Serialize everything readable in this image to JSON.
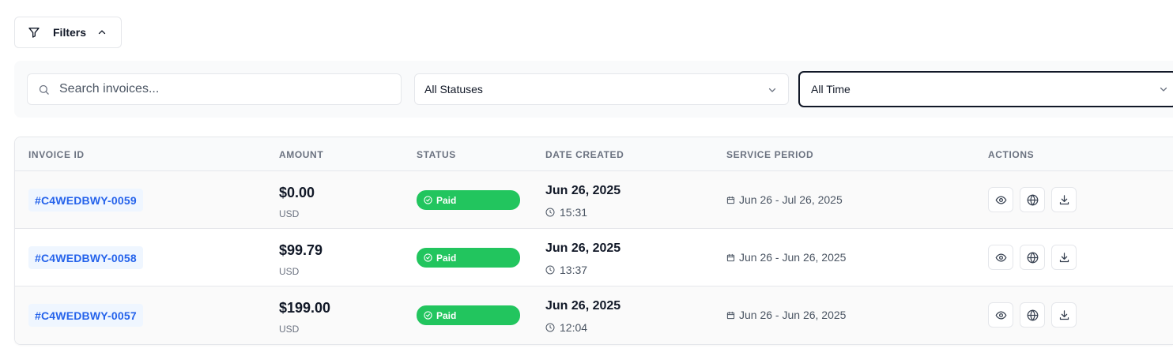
{
  "filters_button": {
    "label": "Filters",
    "icon": "filter-icon",
    "chevron": "chevron-up-icon"
  },
  "search": {
    "placeholder": "Search invoices...",
    "value": "",
    "icon": "search-icon"
  },
  "status_select": {
    "value": "All Statuses",
    "icon": "chevron-down-icon"
  },
  "time_select": {
    "value": "All Time",
    "icon": "chevron-down-icon"
  },
  "table": {
    "headers": {
      "invoice_id": "INVOICE ID",
      "amount": "AMOUNT",
      "status": "STATUS",
      "date_created": "DATE CREATED",
      "service_period": "SERVICE PERIOD",
      "actions": "ACTIONS"
    },
    "rows": [
      {
        "invoice_id": "#C4WEDBWY-0059",
        "amount": "$0.00",
        "currency": "USD",
        "status": "Paid",
        "date": "Jun 26, 2025",
        "time": "15:31",
        "service_period": "Jun 26 - Jul 26, 2025"
      },
      {
        "invoice_id": "#C4WEDBWY-0058",
        "amount": "$99.79",
        "currency": "USD",
        "status": "Paid",
        "date": "Jun 26, 2025",
        "time": "13:37",
        "service_period": "Jun 26 - Jun 26, 2025"
      },
      {
        "invoice_id": "#C4WEDBWY-0057",
        "amount": "$199.00",
        "currency": "USD",
        "status": "Paid",
        "date": "Jun 26, 2025",
        "time": "12:04",
        "service_period": "Jun 26 - Jun 26, 2025"
      }
    ],
    "action_icons": [
      "eye-icon",
      "globe-icon",
      "download-icon"
    ]
  },
  "colors": {
    "accent_link": "#2563eb",
    "id_badge_bg": "#eff6ff",
    "paid_badge": "#22c55e",
    "panel_bg": "#f9fafb",
    "border": "#e5e7eb"
  }
}
